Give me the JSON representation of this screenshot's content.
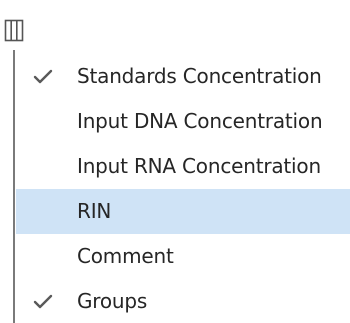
{
  "toolbar": {
    "columns_icon": "column-chooser-icon"
  },
  "menu": {
    "items": [
      {
        "label": "Standards Concentration",
        "checked": true,
        "highlighted": false
      },
      {
        "label": "Input DNA Concentration",
        "checked": false,
        "highlighted": false
      },
      {
        "label": "Input RNA Concentration",
        "checked": false,
        "highlighted": false
      },
      {
        "label": "RIN",
        "checked": false,
        "highlighted": true
      },
      {
        "label": "Comment",
        "checked": false,
        "highlighted": false
      },
      {
        "label": "Groups",
        "checked": true,
        "highlighted": false
      }
    ]
  },
  "colors": {
    "highlight": "#cfe3f6",
    "text": "#262626",
    "check": "#595959"
  }
}
